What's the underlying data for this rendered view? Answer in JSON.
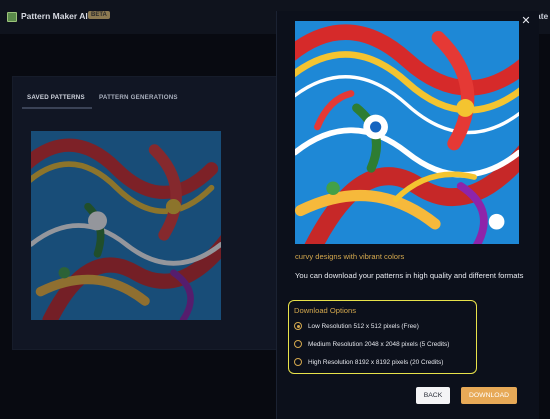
{
  "app": {
    "title": "Pattern Maker AI",
    "badge": "BETA",
    "top_right_partial": "ate",
    "icon": "app-logo-icon"
  },
  "background_panel": {
    "tabs": [
      {
        "label": "SAVED PATTERNS",
        "active": true
      },
      {
        "label": "PATTERN GENERATIONS",
        "active": false
      }
    ]
  },
  "modal": {
    "close_icon": "close-icon",
    "caption": "curvy designs with vibrant colors",
    "description": "You can download your patterns in high quality and different formats",
    "download_options": {
      "title": "Download Options",
      "options": [
        {
          "label": "Low Resolution 512 x 512 pixels (Free)",
          "selected": true
        },
        {
          "label": "Medium Resolution 2048 x 2048 pixels (5 Credits)",
          "selected": false
        },
        {
          "label": "High Resolution 8192 x 8192 pixels (20 Credits)",
          "selected": false
        }
      ]
    },
    "buttons": {
      "back": "BACK",
      "download": "DOWNLOAD"
    }
  },
  "colors": {
    "accent": "#d4a84e",
    "highlight_border": "#e8e24a",
    "download_button": "#e7a957"
  }
}
